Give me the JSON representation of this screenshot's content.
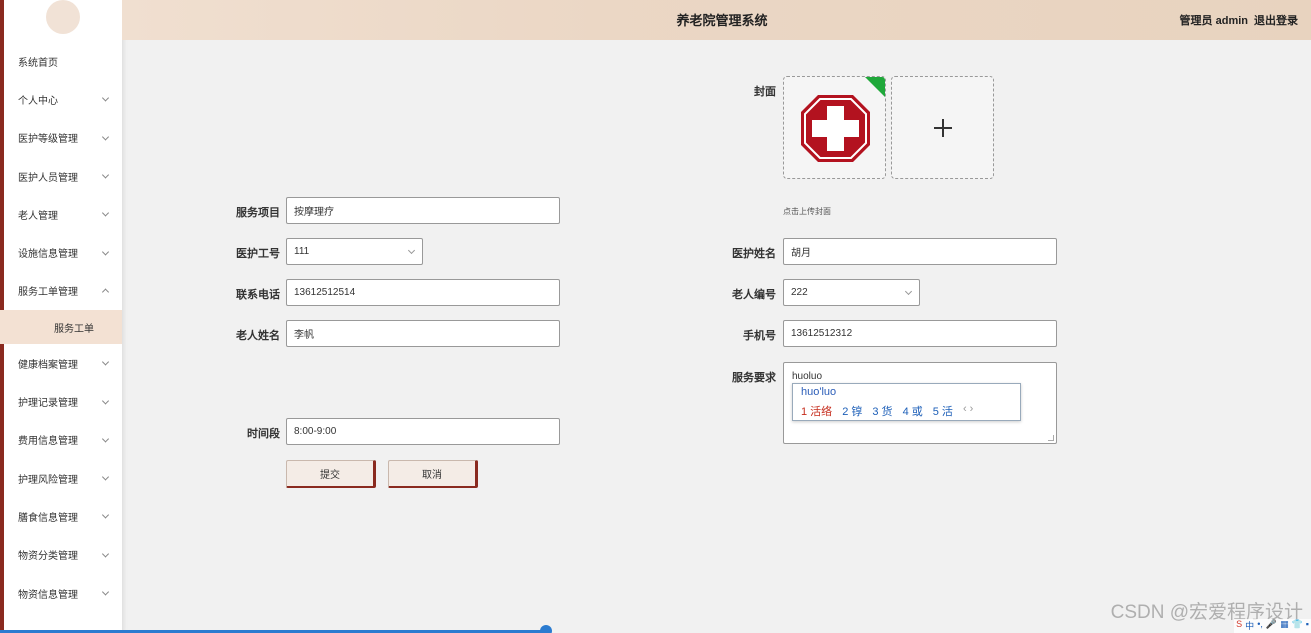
{
  "header": {
    "title": "养老院管理系统",
    "role": "管理员 admin",
    "logout": "退出登录"
  },
  "sidebar": {
    "items": [
      {
        "label": "系统首页",
        "chevron": "none"
      },
      {
        "label": "个人中心",
        "chevron": "down"
      },
      {
        "label": "医护等级管理",
        "chevron": "down"
      },
      {
        "label": "医护人员管理",
        "chevron": "down"
      },
      {
        "label": "老人管理",
        "chevron": "down"
      },
      {
        "label": "设施信息管理",
        "chevron": "down"
      },
      {
        "label": "服务工单管理",
        "chevron": "up"
      }
    ],
    "sub_item": "服务工单",
    "items_after": [
      {
        "label": "健康档案管理"
      },
      {
        "label": "护理记录管理"
      },
      {
        "label": "费用信息管理"
      },
      {
        "label": "护理风险管理"
      },
      {
        "label": "膳食信息管理"
      },
      {
        "label": "物资分类管理"
      },
      {
        "label": "物资信息管理"
      }
    ]
  },
  "form": {
    "cover_label": "封面",
    "cover_hint": "点击上传封面",
    "service_item": {
      "label": "服务项目",
      "value": "按摩理疗"
    },
    "nurse_id": {
      "label": "医护工号",
      "value": "111"
    },
    "phone": {
      "label": "联系电话",
      "value": "13612512514"
    },
    "elder_name": {
      "label": "老人姓名",
      "value": "李帆"
    },
    "time_slot": {
      "label": "时间段",
      "value": "8:00-9:00"
    },
    "nurse_name": {
      "label": "医护姓名",
      "value": "胡月"
    },
    "elder_id": {
      "label": "老人编号",
      "value": "222"
    },
    "mobile": {
      "label": "手机号",
      "value": "13612512312"
    },
    "requirement": {
      "label": "服务要求",
      "value": "huoluo"
    },
    "submit": "提交",
    "cancel": "取消"
  },
  "ime": {
    "composition": "huo'luo",
    "candidates": [
      "1 活络",
      "2 𬭚",
      "3 货",
      "4 或",
      "5 活"
    ]
  },
  "watermark": "CSDN @宏爱程序设计",
  "colors": {
    "accent": "#8a2a1f",
    "header": "#ebd7c5",
    "active": "#f3e1d3"
  }
}
